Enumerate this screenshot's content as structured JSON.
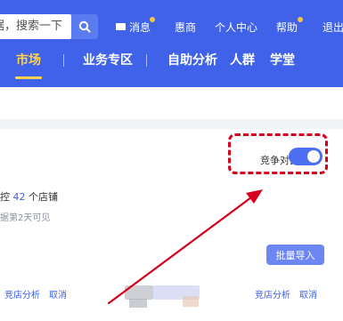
{
  "header": {
    "search_text": "据，搜索一下",
    "links": [
      "消息",
      "惠商",
      "个人中心",
      "帮助",
      "退出"
    ]
  },
  "nav": {
    "items": [
      "市场",
      "业务专区",
      "自助分析",
      "人群",
      "学堂"
    ],
    "active": "市场"
  },
  "compete": {
    "label": "竞争对比",
    "enabled": true
  },
  "content": {
    "shop_prefix": "控",
    "shop_count": "42",
    "shop_suffix": "个店铺",
    "sub_text": "据第2天可见",
    "import_button": "批量导入",
    "row_left_analysis": "竞店分析",
    "row_left_cancel": "取消",
    "row_right_analysis": "竞店分析",
    "row_right_cancel": "取消"
  },
  "colors": {
    "header_bg": "#3f62e8",
    "active_nav": "#ffd24d",
    "highlight": "#d6001c",
    "toggle_on": "#4e6ef2"
  }
}
